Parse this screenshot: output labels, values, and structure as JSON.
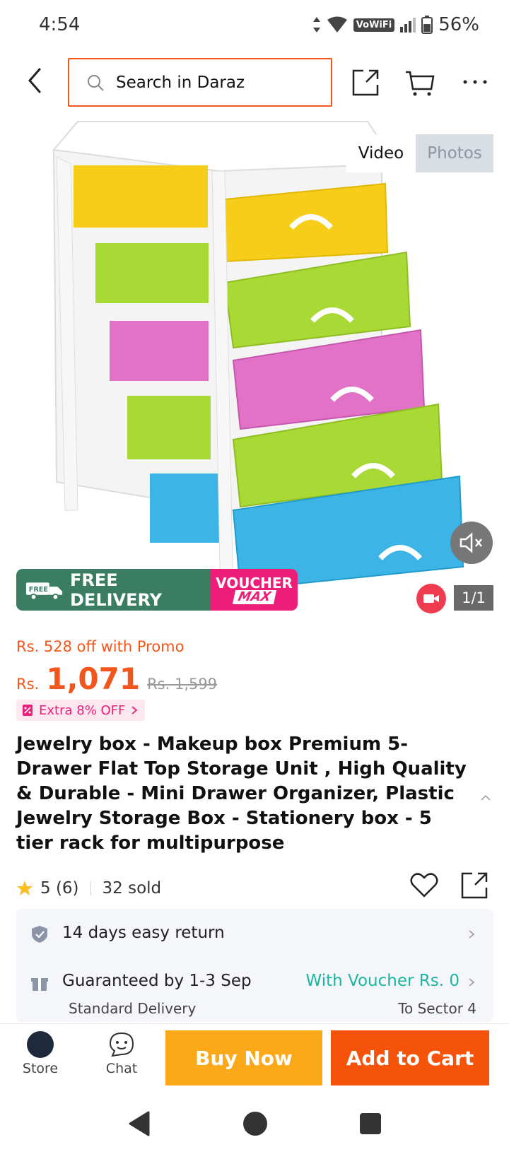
{
  "status": {
    "time": "4:54",
    "network": "VoWiFi",
    "battery": "56%"
  },
  "search": {
    "placeholder": "Search in Daraz"
  },
  "media": {
    "tabs": {
      "video": "Video",
      "photos": "Photos"
    },
    "banner": {
      "free_delivery": "FREE DELIVERY",
      "free_small": "FREE",
      "voucher": "VOUCHER",
      "max": "MAX"
    },
    "counter": "1/1"
  },
  "pricing": {
    "promo": "Rs. 528 off with Promo",
    "currency": "Rs.",
    "price": "1,071",
    "old_price": "Rs. 1,599",
    "extra_off": "Extra 8% OFF"
  },
  "product": {
    "title": "Jewelry box - Makeup box Premium 5-Drawer Flat Top Storage Unit , High Quality & Durable - Mini Drawer Organizer, Plastic Jewelry Storage Box - Stationery box - 5 tier rack for multipurpose",
    "rating": "5 (6)",
    "sold": "32 sold"
  },
  "info": {
    "returns": "14 days easy return",
    "delivery": "Guaranteed by 1-3 Sep",
    "voucher": "With Voucher Rs. 0",
    "standard": "Standard Delivery",
    "to": "To Sector 4"
  },
  "bottom": {
    "store": "Store",
    "chat": "Chat",
    "buy_now": "Buy Now",
    "add_to_cart": "Add to Cart"
  },
  "colors": {
    "accent": "#f2561c",
    "buy": "#fba919",
    "cart": "#f5520a",
    "teal": "#1bb5a2",
    "pink": "#ed1e79"
  }
}
